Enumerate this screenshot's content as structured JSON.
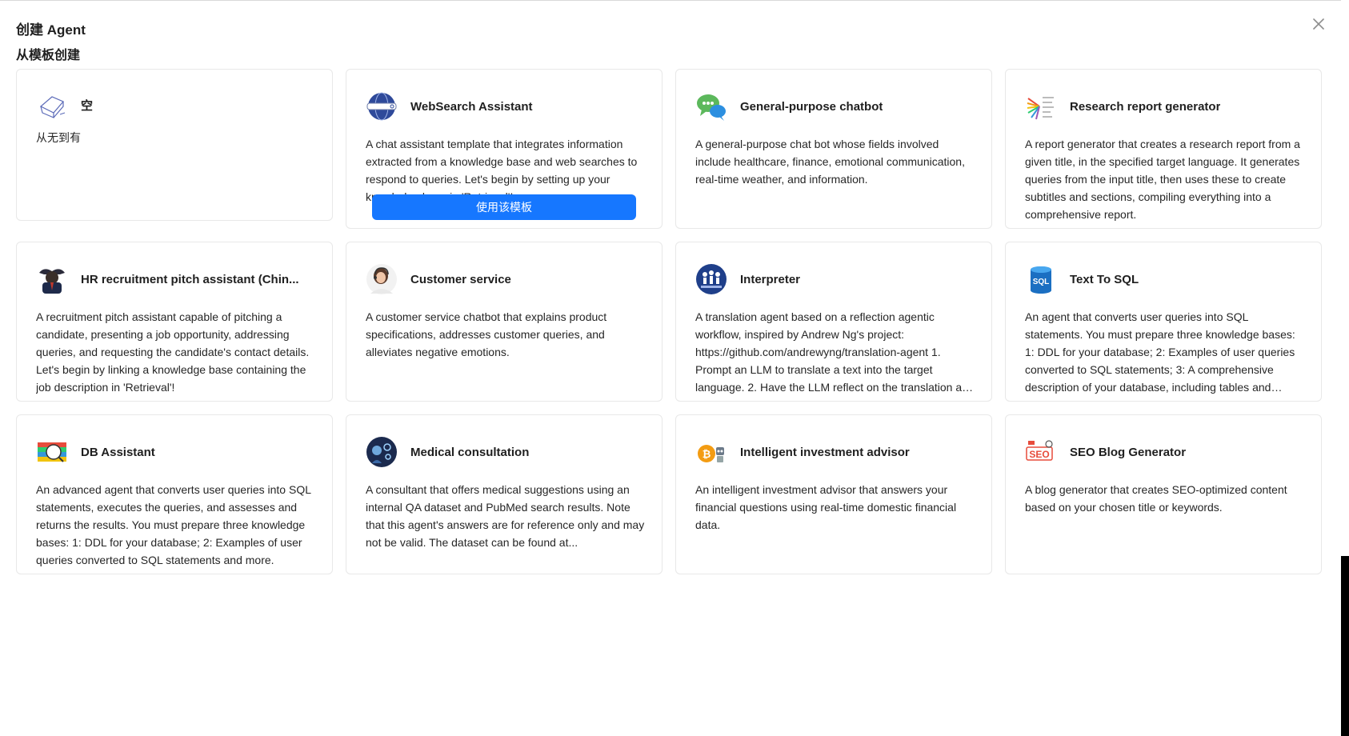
{
  "modal": {
    "title": "创建 Agent",
    "section_title": "从模板创建"
  },
  "colors": {
    "primary": "#1677ff",
    "border": "#e8e8e8"
  },
  "templates": [
    {
      "title": "空",
      "description": "从无到有",
      "icon": "empty-box-icon"
    },
    {
      "title": "WebSearch Assistant",
      "description": "A chat assistant template that integrates information extracted from a knowledge base and web searches to respond to queries. Let's begin by setting up your knowledge base in 'Retrieval'!",
      "icon": "globe-search-icon",
      "hover_button": "使用该模板"
    },
    {
      "title": "General-purpose chatbot",
      "description": "A general-purpose chat bot whose fields involved include healthcare, finance, emotional communication, real-time weather, and information.",
      "icon": "chat-bubbles-icon"
    },
    {
      "title": "Research report generator",
      "description": "A report generator that creates a research report from a given title, in the specified target language. It generates queries from the input title, then uses these to create subtitles and sections, compiling everything into a comprehensive report.",
      "icon": "report-chart-icon"
    },
    {
      "title": "HR recruitment pitch assistant (Chin...",
      "description": "A recruitment pitch assistant capable of pitching a candidate, presenting a job opportunity, addressing queries, and requesting the candidate's contact details. Let's begin by linking a knowledge base containing the job description in 'Retrieval'!",
      "icon": "hr-avatar-icon"
    },
    {
      "title": "Customer service",
      "description": "A customer service chatbot that explains product specifications, addresses customer queries, and alleviates negative emotions.",
      "icon": "customer-service-avatar-icon"
    },
    {
      "title": "Interpreter",
      "description": "A translation agent based on a reflection agentic workflow, inspired by Andrew Ng's project: https://github.com/andrewyng/translation-agent 1. Prompt an LLM to translate a text into the target language. 2. Have the LLM reflect on the translation and suggest improvements.",
      "icon": "interpreter-icon"
    },
    {
      "title": "Text To SQL",
      "description": "An agent that converts user queries into SQL statements. You must prepare three knowledge bases: 1: DDL for your database; 2: Examples of user queries converted to SQL statements; 3: A comprehensive description of your database, including tables and columns.",
      "icon": "sql-database-icon"
    },
    {
      "title": "DB Assistant",
      "description": "An advanced agent that converts user queries into SQL statements, executes the queries, and assesses and returns the results. You must prepare three knowledge bases: 1: DDL for your database; 2: Examples of user queries converted to SQL statements and more.",
      "icon": "db-assistant-icon"
    },
    {
      "title": "Medical consultation",
      "description": "A consultant that offers medical suggestions using an internal QA dataset and PubMed search results. Note that this agent's answers are for reference only and may not be valid. The dataset can be found at...",
      "icon": "medical-icon"
    },
    {
      "title": "Intelligent investment advisor",
      "description": "An intelligent investment advisor that answers your financial questions using real-time domestic financial data.",
      "icon": "bitcoin-robot-icon"
    },
    {
      "title": "SEO Blog Generator",
      "description": "A blog generator that creates SEO-optimized content based on your chosen title or keywords.",
      "icon": "seo-icon"
    }
  ]
}
